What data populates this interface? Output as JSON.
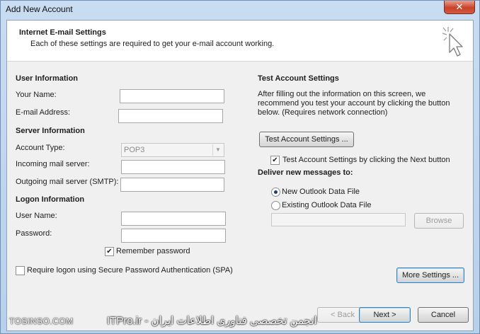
{
  "window": {
    "title": "Add New Account",
    "close_glyph": "✕"
  },
  "header": {
    "title": "Internet E-mail Settings",
    "subtitle": "Each of these settings are required to get your e-mail account working.",
    "icon": "cursor-sparkle-icon"
  },
  "user_info": {
    "heading": "User Information",
    "your_name_label": "Your Name:",
    "your_name_value": "",
    "email_label": "E-mail Address:",
    "email_value": ""
  },
  "server_info": {
    "heading": "Server Information",
    "account_type_label": "Account Type:",
    "account_type_value": "POP3",
    "incoming_label": "Incoming mail server:",
    "incoming_value": "",
    "outgoing_label": "Outgoing mail server (SMTP):",
    "outgoing_value": ""
  },
  "logon_info": {
    "heading": "Logon Information",
    "username_label": "User Name:",
    "username_value": "",
    "password_label": "Password:",
    "password_value": "",
    "remember_label": "Remember password",
    "remember_checked": true,
    "spa_label": "Require logon using Secure Password Authentication (SPA)",
    "spa_checked": false
  },
  "test_settings": {
    "heading": "Test Account Settings",
    "description": "After filling out the information on this screen, we recommend you test your account by clicking the button below. (Requires network connection)",
    "test_button": "Test Account Settings ...",
    "next_checkbox_label": "Test Account Settings by clicking the Next button",
    "next_checkbox_checked": true
  },
  "deliver": {
    "heading": "Deliver new messages to:",
    "new_file_label": "New Outlook Data File",
    "existing_file_label": "Existing Outlook Data File",
    "selected": "new",
    "browse_button": "Browse"
  },
  "more_settings_button": "More Settings ...",
  "footer": {
    "back_button": "< Back",
    "next_button": "Next >",
    "cancel_button": "Cancel"
  },
  "watermark": {
    "site": "TOSINSO.COM",
    "arabic": "انجمن تخصصی فناوری اطلاعات ایران - ITPro.ir"
  },
  "colors": {
    "window_frame": "#b9d0ea",
    "close_button": "#c7432b",
    "default_button_border": "#3c7fb1"
  }
}
